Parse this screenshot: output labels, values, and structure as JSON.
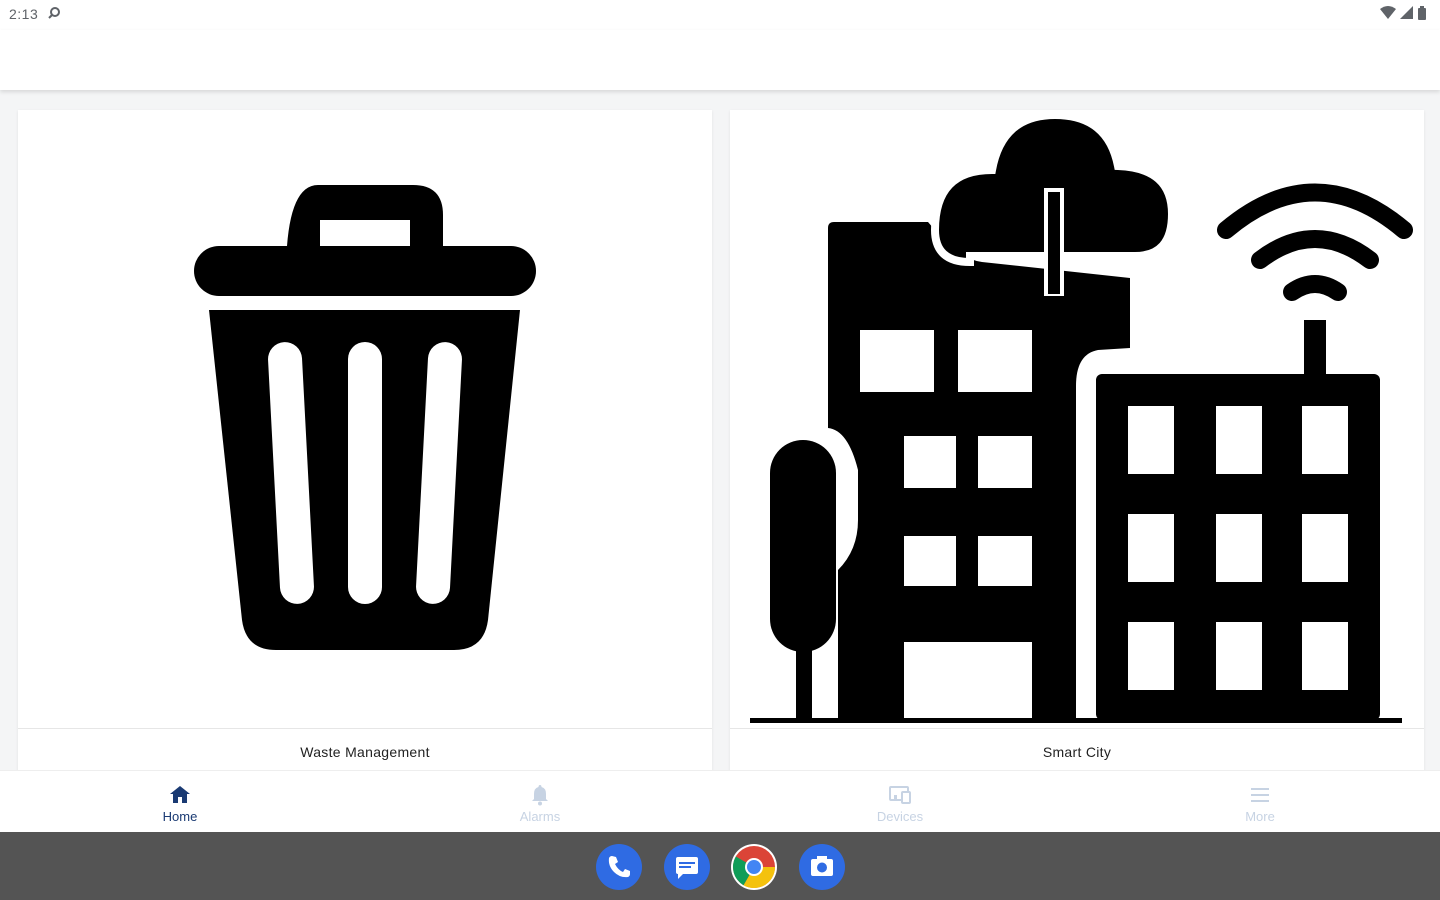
{
  "status_bar": {
    "time": "2:13"
  },
  "cards": [
    {
      "label": "Waste Management",
      "icon": "trash-can-icon"
    },
    {
      "label": "Smart City",
      "icon": "smart-city-icon"
    }
  ],
  "bottom_nav": {
    "items": [
      {
        "label": "Home",
        "icon": "home-icon",
        "active": true
      },
      {
        "label": "Alarms",
        "icon": "bell-icon",
        "active": false
      },
      {
        "label": "Devices",
        "icon": "devices-icon",
        "active": false
      },
      {
        "label": "More",
        "icon": "menu-icon",
        "active": false
      }
    ]
  },
  "dock": {
    "apps": [
      {
        "name": "Phone",
        "icon": "phone-icon"
      },
      {
        "name": "Messages",
        "icon": "messages-icon"
      },
      {
        "name": "Chrome",
        "icon": "chrome-icon"
      },
      {
        "name": "Camera",
        "icon": "camera-icon"
      }
    ]
  },
  "colors": {
    "accent": "#1a3a73",
    "inactive_nav": "#c7d3e3",
    "dock_background": "#545454",
    "dock_blue": "#2f6be3"
  }
}
